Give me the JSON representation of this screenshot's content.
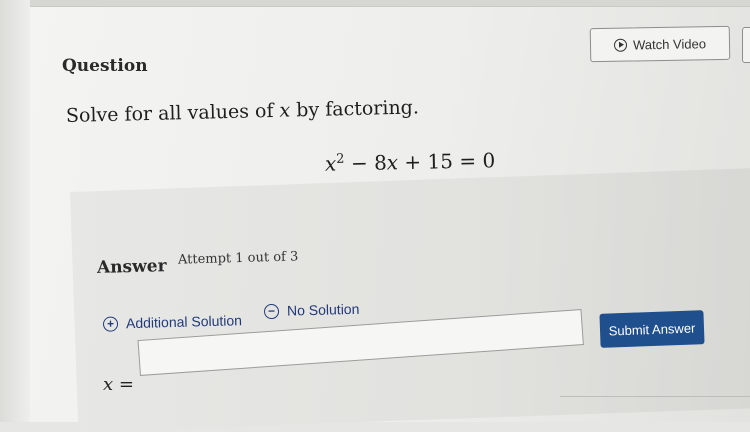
{
  "question": {
    "label": "Question",
    "watch_video_label": "Watch Video",
    "prompt_before": "Solve for all values of ",
    "prompt_var": "x",
    "prompt_after": " by factoring.",
    "equation": {
      "var": "x",
      "exp": "2",
      "middle": " − 8",
      "var2": "x",
      "rest": " + 15 = 0"
    }
  },
  "answer": {
    "label": "Answer",
    "attempt_text": "Attempt 1 out of 3",
    "additional_solution_label": "Additional Solution",
    "no_solution_label": "No Solution",
    "input_prefix_var": "x",
    "input_prefix_eq": " =",
    "input_value": "",
    "submit_label": "Submit Answer"
  },
  "icons": {
    "watch_video": "play-circle-icon",
    "additional_solution": "plus-circle-icon",
    "no_solution": "minus-circle-icon",
    "cursor": "mouse-pointer-icon"
  },
  "colors": {
    "submit_bg": "#1f4f8c",
    "link_blue": "#223a7a"
  }
}
